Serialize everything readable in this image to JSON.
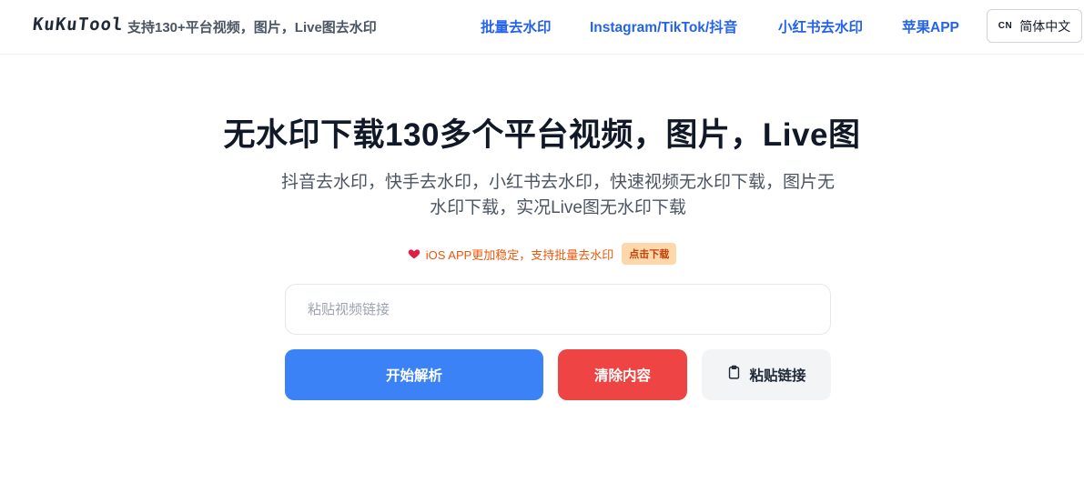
{
  "header": {
    "brand": "KuKuTool",
    "tagline": "支持130+平台视频，图片，Live图去水印",
    "nav": [
      {
        "label": "批量去水印"
      },
      {
        "label": "Instagram/TikTok/抖音"
      },
      {
        "label": "小红书去水印"
      },
      {
        "label": "苹果APP"
      }
    ],
    "language": {
      "code": "CN",
      "label": "简体中文"
    }
  },
  "hero": {
    "title": "无水印下载130多个平台视频，图片，Live图",
    "subtitle": "抖音去水印，快手去水印，小红书去水印，快速视频无水印下载，图片无水印下载，实况Live图无水印下载"
  },
  "promo": {
    "icon": "heart-icon",
    "text": "iOS APP更加稳定，支持批量去水印",
    "badge": "点击下载"
  },
  "form": {
    "input_value": "",
    "input_placeholder": "粘贴视频链接",
    "parse_label": "开始解析",
    "clear_label": "清除内容",
    "paste_label": "粘贴链接",
    "paste_icon": "clipboard-icon"
  },
  "colors": {
    "accent": "#2563eb",
    "primary_button": "#3b82f6",
    "danger_button": "#ef4444",
    "promo_text": "#ea580c",
    "heart": "#e11d48"
  }
}
